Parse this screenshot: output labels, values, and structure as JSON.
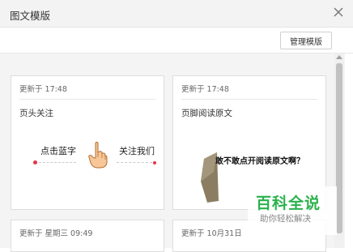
{
  "window": {
    "title": "图文模版",
    "close_icon": "close-icon"
  },
  "toolbar": {
    "manage_label": "管理模版"
  },
  "cards": [
    {
      "updated": "更新于 17:48",
      "title": "页头关注",
      "preview": {
        "left_text": "点击蓝字",
        "right_text": "关注我们",
        "icon": "pointing-hand-icon"
      }
    },
    {
      "updated": "更新于 17:48",
      "title": "页脚阅读原文",
      "preview": {
        "text": "敢不敢点开阅读原文啊？",
        "icon": "folded-paper-icon"
      }
    },
    {
      "updated": "更新于 星期三 09:49"
    },
    {
      "updated": "更新于 10月31日"
    }
  ],
  "watermark": {
    "main": "百科全说",
    "sub": "助你轻松解决"
  },
  "colors": {
    "accent_red": "#e8334a",
    "watermark_green": "#2bb24c"
  }
}
